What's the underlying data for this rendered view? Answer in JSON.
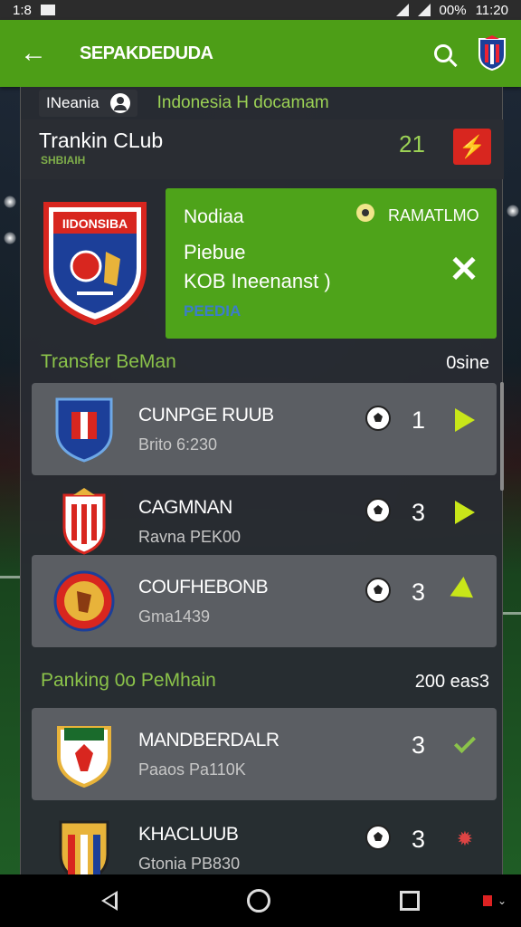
{
  "status_bar": {
    "left_text": "1:8",
    "battery": "00%",
    "time": "11:20"
  },
  "app_bar": {
    "title": "SEPAKDEDUDA",
    "back_icon": "arrow-left-icon",
    "search_icon": "search-icon",
    "crest_icon": "club-crest-icon"
  },
  "header": {
    "chip_label": "INeania",
    "league_title": "Indonesia H docamam",
    "club_name": "Trankin CLub",
    "club_sub": "SHBIAIH",
    "club_score": "21",
    "flash_icon": "lightning-icon"
  },
  "featured": {
    "crest_text": "IIDONSIBA",
    "notice": {
      "title": "Nodiaa",
      "right_label": "RAMATLMO",
      "line1": "Piebue",
      "line2": "KOB Ineenanst )",
      "footer": "PEEDIA",
      "close_icon": "close-icon"
    }
  },
  "sections": [
    {
      "title": "Transfer BeMan",
      "right_label": "0sine",
      "rows": [
        {
          "name": "CUNPGE RUUB",
          "sub": "Brito 6:230",
          "value": "1",
          "action": "arrow-right-icon",
          "highlighted": true
        },
        {
          "name": "CAGMNAN",
          "sub": "Ravna PEK00",
          "value": "3",
          "action": "arrow-right-icon",
          "highlighted": false
        },
        {
          "name": "COUFHEBONB",
          "sub": "Gma1439",
          "value": "3",
          "action": "chevron-down-icon",
          "highlighted": true
        }
      ]
    },
    {
      "title": "Panking 0o PeMhain",
      "right_label": "200 eas3",
      "rows": [
        {
          "name": "MANDBERDALR",
          "sub": "Paaos Pa110K",
          "value": "3",
          "action": "check-icon",
          "highlighted": true
        },
        {
          "name": "KHACLUUB",
          "sub": "Gtonia PB830",
          "value": "3",
          "action": "badge-icon",
          "highlighted": false
        }
      ]
    }
  ],
  "colors": {
    "app_bar": "#4d9e17",
    "accent_green": "#8bc34a",
    "notice_bg": "#4ea31a",
    "flash_button": "#d8261f",
    "arrow": "#c8e619"
  }
}
